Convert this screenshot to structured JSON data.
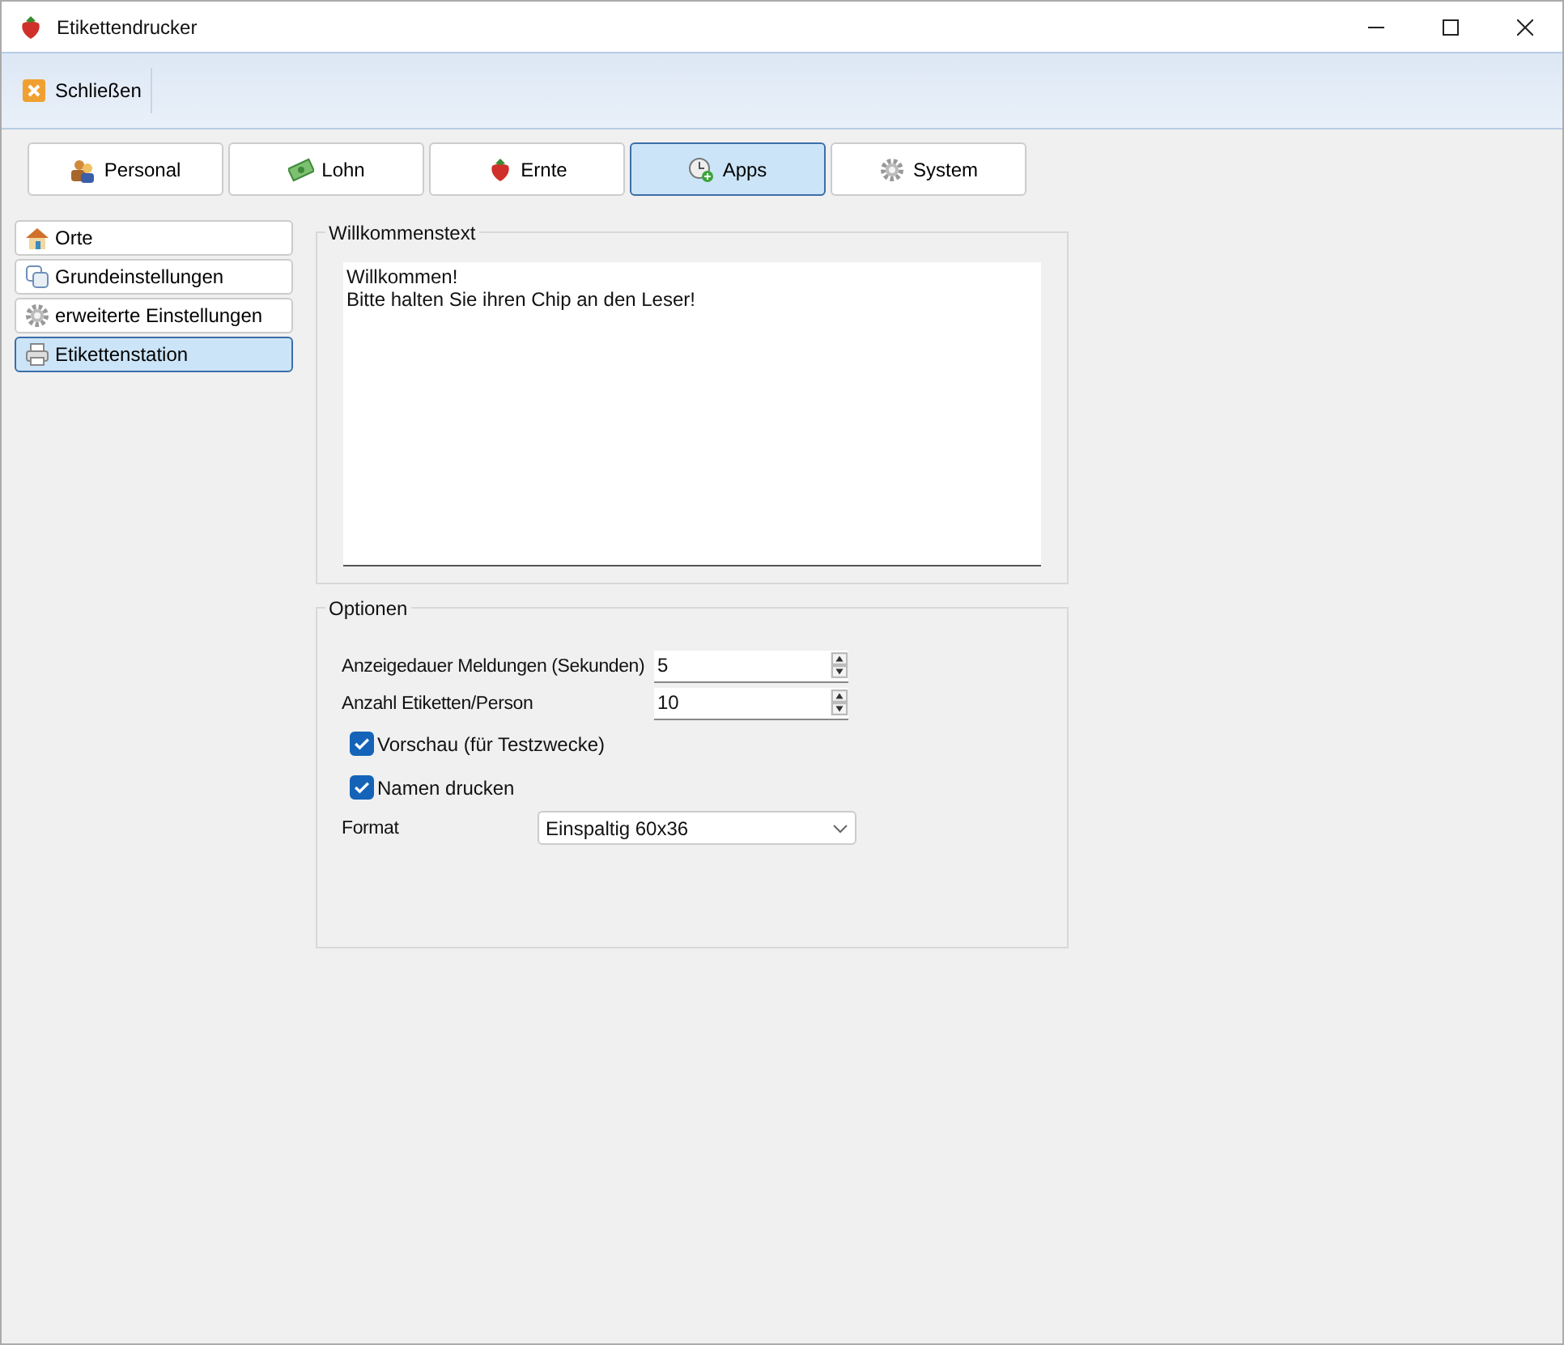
{
  "window": {
    "title": "Etikettendrucker"
  },
  "toolbar": {
    "buttons": [
      {
        "label": "Schließen",
        "kind": "close"
      }
    ]
  },
  "tabs": [
    {
      "label": "Personal",
      "kind": "people",
      "selected": false
    },
    {
      "label": "Lohn",
      "kind": "money",
      "selected": false
    },
    {
      "label": "Ernte",
      "kind": "strawberry",
      "selected": false
    },
    {
      "label": "Apps",
      "kind": "clock",
      "selected": true
    },
    {
      "label": "System",
      "kind": "gear",
      "selected": false
    }
  ],
  "sidebar": {
    "items": [
      {
        "label": "Orte",
        "kind": "house",
        "selected": false
      },
      {
        "label": "Grundeinstellungen",
        "kind": "copy",
        "selected": false
      },
      {
        "label": "erweiterte Einstellungen",
        "kind": "gear",
        "selected": false
      },
      {
        "label": "Etikettenstation",
        "kind": "printer",
        "selected": true
      }
    ]
  },
  "welcome": {
    "title": "Willkommenstext",
    "lines": [
      "Willkommen!",
      "Bitte halten Sie ihren Chip an den Leser!"
    ]
  },
  "options": {
    "title": "Optionen",
    "rows": [
      {
        "kind": "spinner",
        "label": "Anzeigedauer Meldungen (Sekunden)",
        "value": "5"
      },
      {
        "kind": "spinner",
        "label": "Anzahl Etiketten/Person",
        "value": "10"
      },
      {
        "kind": "checkbox",
        "label": "Vorschau (für Testzwecke)",
        "checked": true
      },
      {
        "kind": "checkbox",
        "label": "Namen drucken",
        "checked": true
      },
      {
        "kind": "dropdown",
        "label": "Format",
        "value": "Einspaltig 60x36"
      }
    ]
  }
}
